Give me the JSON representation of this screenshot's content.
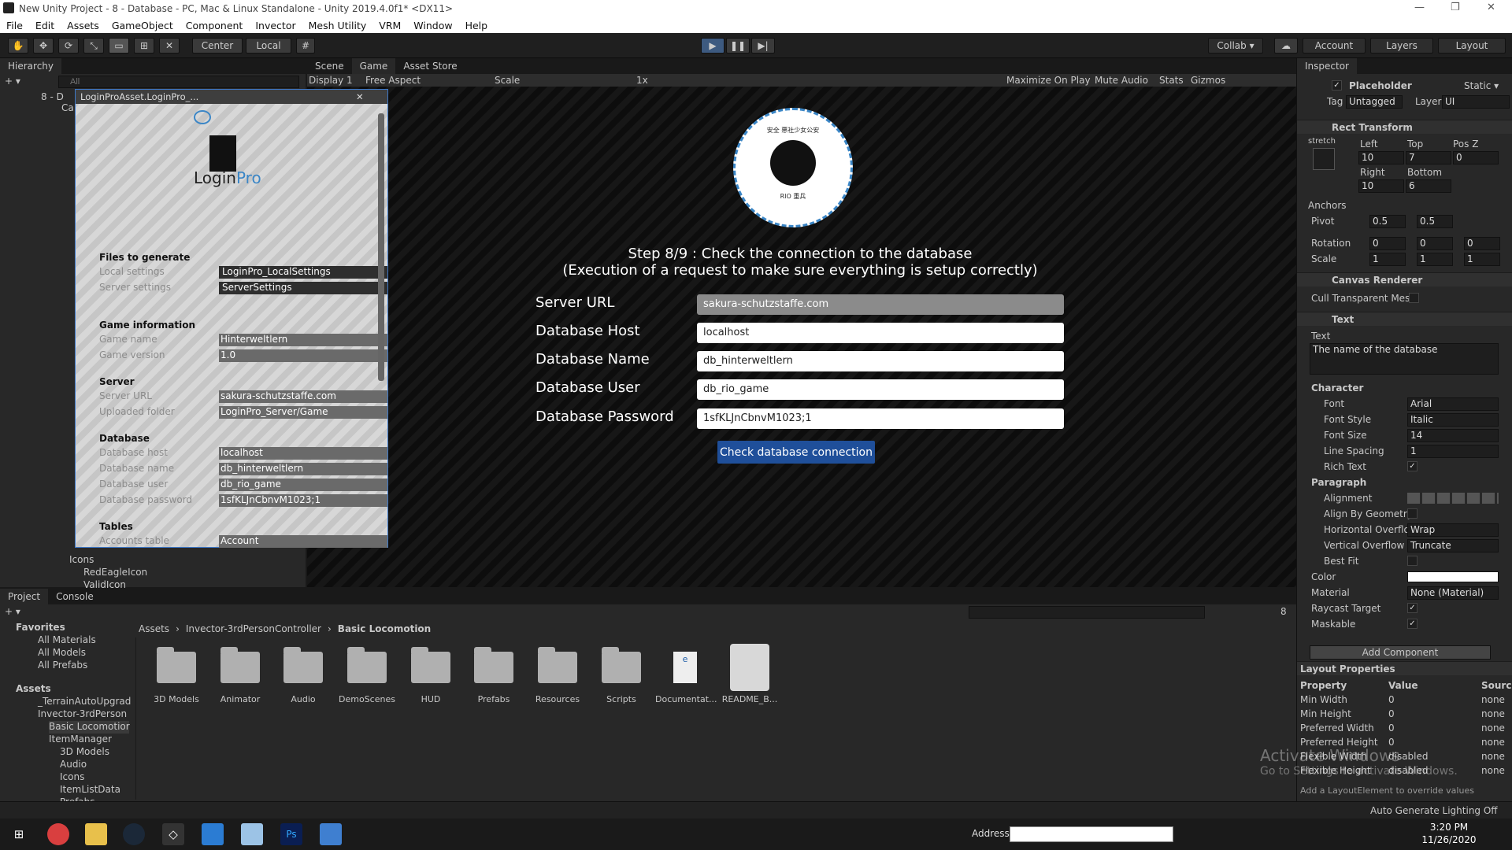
{
  "window": {
    "title": "New Unity Project - 8 - Database - PC, Mac & Linux Standalone - Unity 2019.4.0f1* <DX11>",
    "minimize": "—",
    "restore": "❐",
    "close": "✕"
  },
  "menu": [
    "File",
    "Edit",
    "Assets",
    "GameObject",
    "Component",
    "Invector",
    "Mesh Utility",
    "VRM",
    "Window",
    "Help"
  ],
  "toolbar": {
    "tools": [
      "✋",
      "✥",
      "⟳",
      "⤡",
      "▭",
      "⊞",
      "✕"
    ],
    "pivot": "Center",
    "space": "Local",
    "grid": "#",
    "play": "▶",
    "pause": "❚❚",
    "step": "▶|",
    "collab": "Collab ▾",
    "cloud": "☁",
    "account": "Account",
    "layers": "Layers",
    "layout": "Layout"
  },
  "hierarchy": {
    "tab": "Hierarchy",
    "add": "+ ▾",
    "search_placeholder": "All",
    "rows": [
      "8 - D",
      "Ca",
      "",
      "",
      "",
      "",
      "",
      "",
      "",
      "",
      "",
      "",
      "",
      "",
      "",
      "",
      "",
      "",
      "",
      "",
      "",
      "",
      "",
      "",
      "",
      "",
      "",
      "",
      "Icons",
      "RedEagleIcon",
      "ValidIcon"
    ],
    "icons_label": "Icons",
    "red_eagle": "RedEagleIcon",
    "valid_icon": "ValidIcon"
  },
  "game": {
    "tabs": [
      "Scene",
      "Game",
      "Asset Store"
    ],
    "display": "Display 1",
    "aspect": "Free Aspect",
    "scale_label": "Scale",
    "scale_value": "1x",
    "maximize": "Maximize On Play",
    "mute": "Mute Audio",
    "stats": "Stats",
    "gizmos": "Gizmos",
    "logo_top": "安全 悪社少女公安",
    "logo_bottom": "RIO 重兵",
    "step_line1": "Step 8/9 : Check the connection to the database",
    "step_line2": "(Execution of a request to make sure everything is setup correctly)",
    "fields": [
      {
        "label": "Server URL",
        "value": "sakura-schutzstaffe.com"
      },
      {
        "label": "Database Host",
        "value": "localhost"
      },
      {
        "label": "Database Name",
        "value": "db_hinterweltlern"
      },
      {
        "label": "Database User",
        "value": "db_rio_game"
      },
      {
        "label": "Database Password",
        "value": "1sfKLJnCbnvM1023;1"
      }
    ],
    "button": "Check database connection"
  },
  "loginpro": {
    "header": "LoginProAsset.LoginPro_...",
    "logo_login": "Login",
    "logo_pro": "Pro",
    "files_title": "Files to generate",
    "local_settings_label": "Local settings",
    "local_settings_value": "LoginPro_LocalSettings",
    "server_settings_label": "Server settings",
    "server_settings_value": "ServerSettings",
    "game_info_title": "Game information",
    "game_name_label": "Game name",
    "game_name_value": "Hinterweltlern",
    "game_version_label": "Game version",
    "game_version_value": "1.0",
    "server_title": "Server",
    "server_url_label": "Server URL",
    "server_url_value": "sakura-schutzstaffe.com",
    "uploaded_label": "Uploaded folder",
    "uploaded_value": "LoginPro_Server/Game",
    "database_title": "Database",
    "db_host_label": "Database host",
    "db_host_value": "localhost",
    "db_name_label": "Database name",
    "db_name_value": "db_hinterweltlern",
    "db_user_label": "Database user",
    "db_user_value": "db_rio_game",
    "db_pass_label": "Database password",
    "db_pass_value": "1sfKLJnCbnvM1023;1",
    "tables_title": "Tables",
    "accounts_label": "Accounts table",
    "accounts_value": "Account"
  },
  "inspector": {
    "tab": "Inspector",
    "object_name": "Placeholder",
    "static": "Static ▾",
    "tag_label": "Tag",
    "tag_value": "Untagged",
    "layer_label": "Layer",
    "layer_value": "UI",
    "rect_transform": "Rect Transform",
    "stretch": "stretch",
    "left_label": "Left",
    "left_value": "10",
    "top_label": "Top",
    "top_value": "7",
    "posz_label": "Pos Z",
    "posz_value": "0",
    "right_label": "Right",
    "right_value": "10",
    "bottom_label": "Bottom",
    "bottom_value": "6",
    "anchors": "Anchors",
    "pivot_label": "Pivot",
    "pivot_x": "0.5",
    "pivot_y": "0.5",
    "rotation_label": "Rotation",
    "rot_x": "0",
    "rot_y": "0",
    "rot_z": "0",
    "scale_label": "Scale",
    "scale_x": "1",
    "scale_y": "1",
    "scale_z": "1",
    "canvas_renderer": "Canvas Renderer",
    "cull": "Cull Transparent Mes",
    "text_comp": "Text",
    "text_label": "Text",
    "text_value": "The name of the database",
    "character": "Character",
    "font_label": "Font",
    "font_value": "Arial",
    "font_style_label": "Font Style",
    "font_style_value": "Italic",
    "font_size_label": "Font Size",
    "font_size_value": "14",
    "line_spacing_label": "Line Spacing",
    "line_spacing_value": "1",
    "rich_text_label": "Rich Text",
    "paragraph": "Paragraph",
    "alignment_label": "Alignment",
    "align_geom_label": "Align By Geometry",
    "h_overflow_label": "Horizontal Overflo",
    "h_overflow_value": "Wrap",
    "v_overflow_label": "Vertical Overflow",
    "v_overflow_value": "Truncate",
    "best_fit_label": "Best Fit",
    "color_label": "Color",
    "material_label": "Material",
    "material_value": "None (Material)",
    "raycast_label": "Raycast Target",
    "maskable_label": "Maskable",
    "add_component": "Add Component",
    "layout_props": "Layout Properties",
    "lp_headers": [
      "Property",
      "Value",
      "Source"
    ],
    "lp_rows": [
      [
        "Min Width",
        "0",
        "none"
      ],
      [
        "Min Height",
        "0",
        "none"
      ],
      [
        "Preferred Width",
        "0",
        "none"
      ],
      [
        "Preferred Height",
        "0",
        "none"
      ],
      [
        "Flexible Width",
        "disabled",
        "none"
      ],
      [
        "Flexible Height",
        "disabled",
        "none"
      ]
    ],
    "lp_footer": "Add a LayoutElement to override values"
  },
  "project": {
    "tabs": [
      "Project",
      "Console"
    ],
    "add": "+ ▾",
    "hidden_count": "8",
    "breadcrumb": [
      "Assets",
      "Invector-3rdPersonController",
      "Basic Locomotion"
    ],
    "favorites": "Favorites",
    "fav_items": [
      "All Materials",
      "All Models",
      "All Prefabs"
    ],
    "assets_root": "Assets",
    "tree": [
      "_TerrainAutoUpgrad",
      "Invector-3rdPerson",
      "Basic Locomotior",
      "ItemManager",
      "3D Models",
      "Audio",
      "Icons",
      "ItemListData",
      "Prefabs"
    ],
    "items": [
      "3D Models",
      "Animator",
      "Audio",
      "DemoScenes",
      "HUD",
      "Prefabs",
      "Resources",
      "Scripts",
      "Documentat...",
      "README_B..."
    ]
  },
  "status": {
    "text": "Auto Generate Lighting Off"
  },
  "activate": {
    "line1": "Activate Windows",
    "line2": "Go to Settings to activate Windows."
  },
  "taskbar": {
    "address_label": "Address",
    "time": "3:20 PM",
    "date": "11/26/2020"
  }
}
